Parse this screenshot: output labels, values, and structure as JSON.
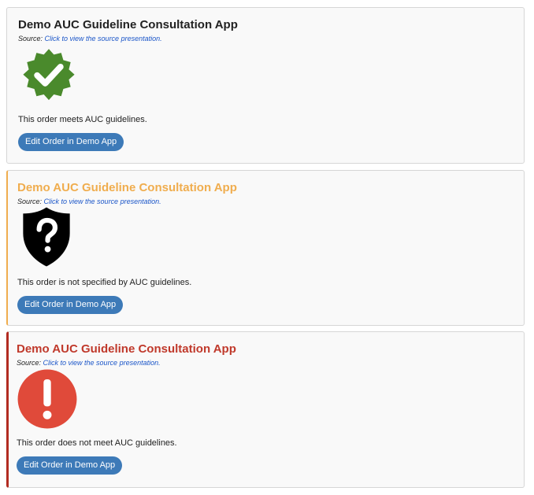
{
  "cards": [
    {
      "title": "Demo AUC Guideline Consultation App",
      "source_prefix": "Source: ",
      "source_link": "Click to view the source presentation.",
      "icon": "checkmark-badge-icon",
      "icon_color": "#4a8a2c",
      "title_color": "#222222",
      "message": "This order meets AUC guidelines.",
      "button_label": "Edit Order in Demo App"
    },
    {
      "title": "Demo AUC Guideline Consultation App",
      "source_prefix": "Source: ",
      "source_link": "Click to view the source presentation.",
      "icon": "question-shield-icon",
      "icon_color": "#000000",
      "title_color": "#f0ad4e",
      "message": "This order is not specified by AUC guidelines.",
      "button_label": "Edit Order in Demo App"
    },
    {
      "title": "Demo AUC Guideline Consultation App",
      "source_prefix": "Source: ",
      "source_link": "Click to view the source presentation.",
      "icon": "exclamation-circle-icon",
      "icon_color": "#e04a3a",
      "title_color": "#c0392b",
      "message": "This order does not meet AUC guidelines.",
      "button_label": "Edit Order in Demo App"
    }
  ],
  "colors": {
    "button_bg": "#3d7ab8",
    "link": "#1a55c8",
    "card_bg": "#f9f9f9"
  }
}
